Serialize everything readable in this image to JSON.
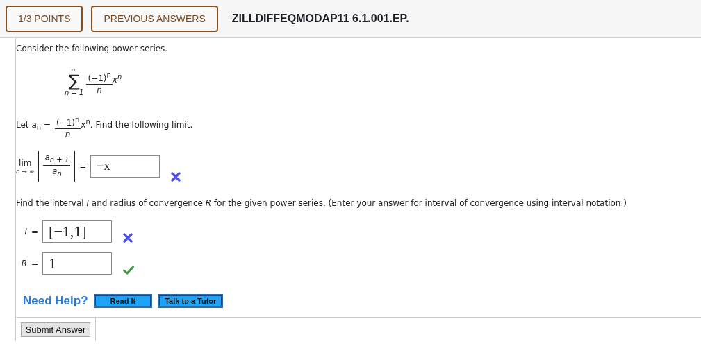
{
  "header": {
    "points": "1/3 POINTS",
    "previous": "PREVIOUS ANSWERS",
    "problem_id": "ZILLDIFFEQMODAP11 6.1.001.EP."
  },
  "intro": "Consider the following power series.",
  "series": {
    "symbol": "∑",
    "upper": "∞",
    "lower": "n = 1",
    "numerator": "(−1)$^{n}$",
    "denominator": "n",
    "factor": "x$^{n}$"
  },
  "definition": {
    "lead": "Let a$_{n}$ =",
    "numerator": "(−1)$^{n}$",
    "denominator": "n",
    "after": "x$^{n}$. Find the following limit."
  },
  "limit": {
    "operator": "lim",
    "subscript": "n → ∞",
    "numerator": "a$_{n + 1}$",
    "denominator": "a$_{n}$",
    "equals": "=",
    "answer": "−x",
    "correct": false
  },
  "instruction": "Find the interval *I* and radius of convergence *R* for the given power series. (Enter your answer for interval of convergence using interval notation.)",
  "answers": [
    {
      "label": "I",
      "equals": "=",
      "value": "[−1,1]",
      "correct": false
    },
    {
      "label": "R",
      "equals": "=",
      "value": "1",
      "correct": true
    }
  ],
  "help": {
    "label": "Need Help?",
    "buttons": [
      "Read It",
      "Talk to a Tutor"
    ]
  },
  "submit": "Submit Answer"
}
